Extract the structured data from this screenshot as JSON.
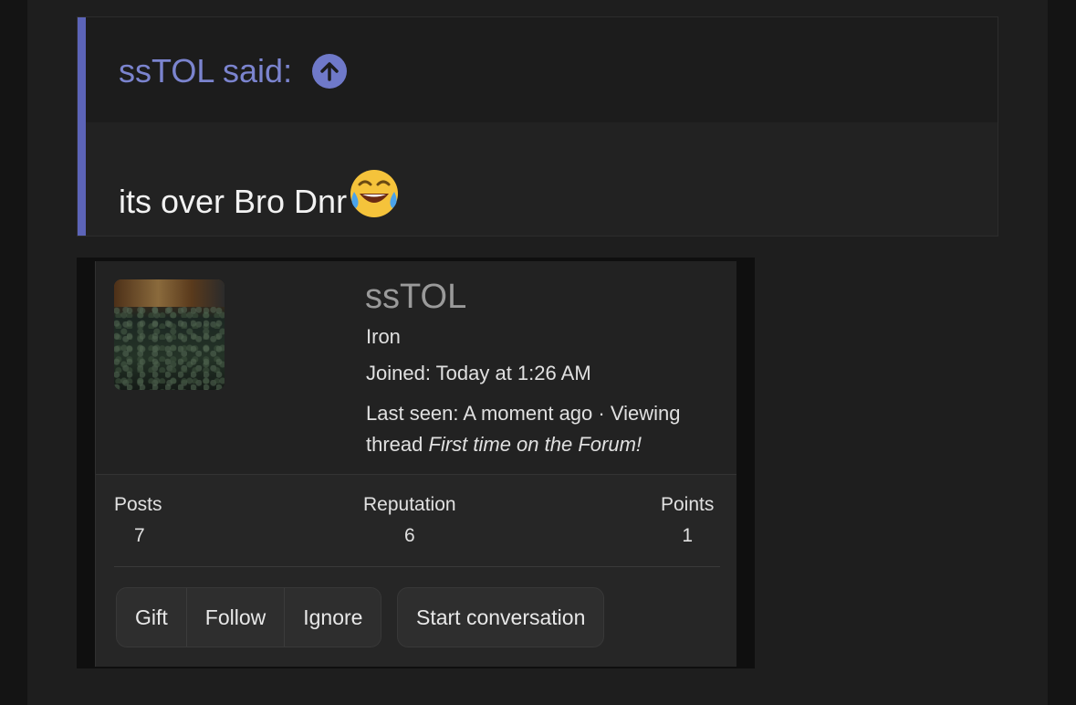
{
  "quote": {
    "author_label": "ssTOL said:",
    "body_text": "its over Bro Dnr",
    "icons": [
      "arrow-up-circle-icon",
      "laughing-crying-emoji-icon"
    ],
    "accent_color": "#5c64b8"
  },
  "member": {
    "username": "ssTOL",
    "rank": "Iron",
    "joined": "Joined: Today at 1:26 AM",
    "last_seen_prefix": "Last seen: A moment ago · Viewing thread ",
    "last_seen_thread": "First time on the Forum!",
    "stats": [
      {
        "label": "Posts",
        "value": "7"
      },
      {
        "label": "Reputation",
        "value": "6"
      },
      {
        "label": "Points",
        "value": "1"
      }
    ],
    "actions": {
      "gift": "Gift",
      "follow": "Follow",
      "ignore": "Ignore",
      "start_conversation": "Start conversation"
    }
  }
}
